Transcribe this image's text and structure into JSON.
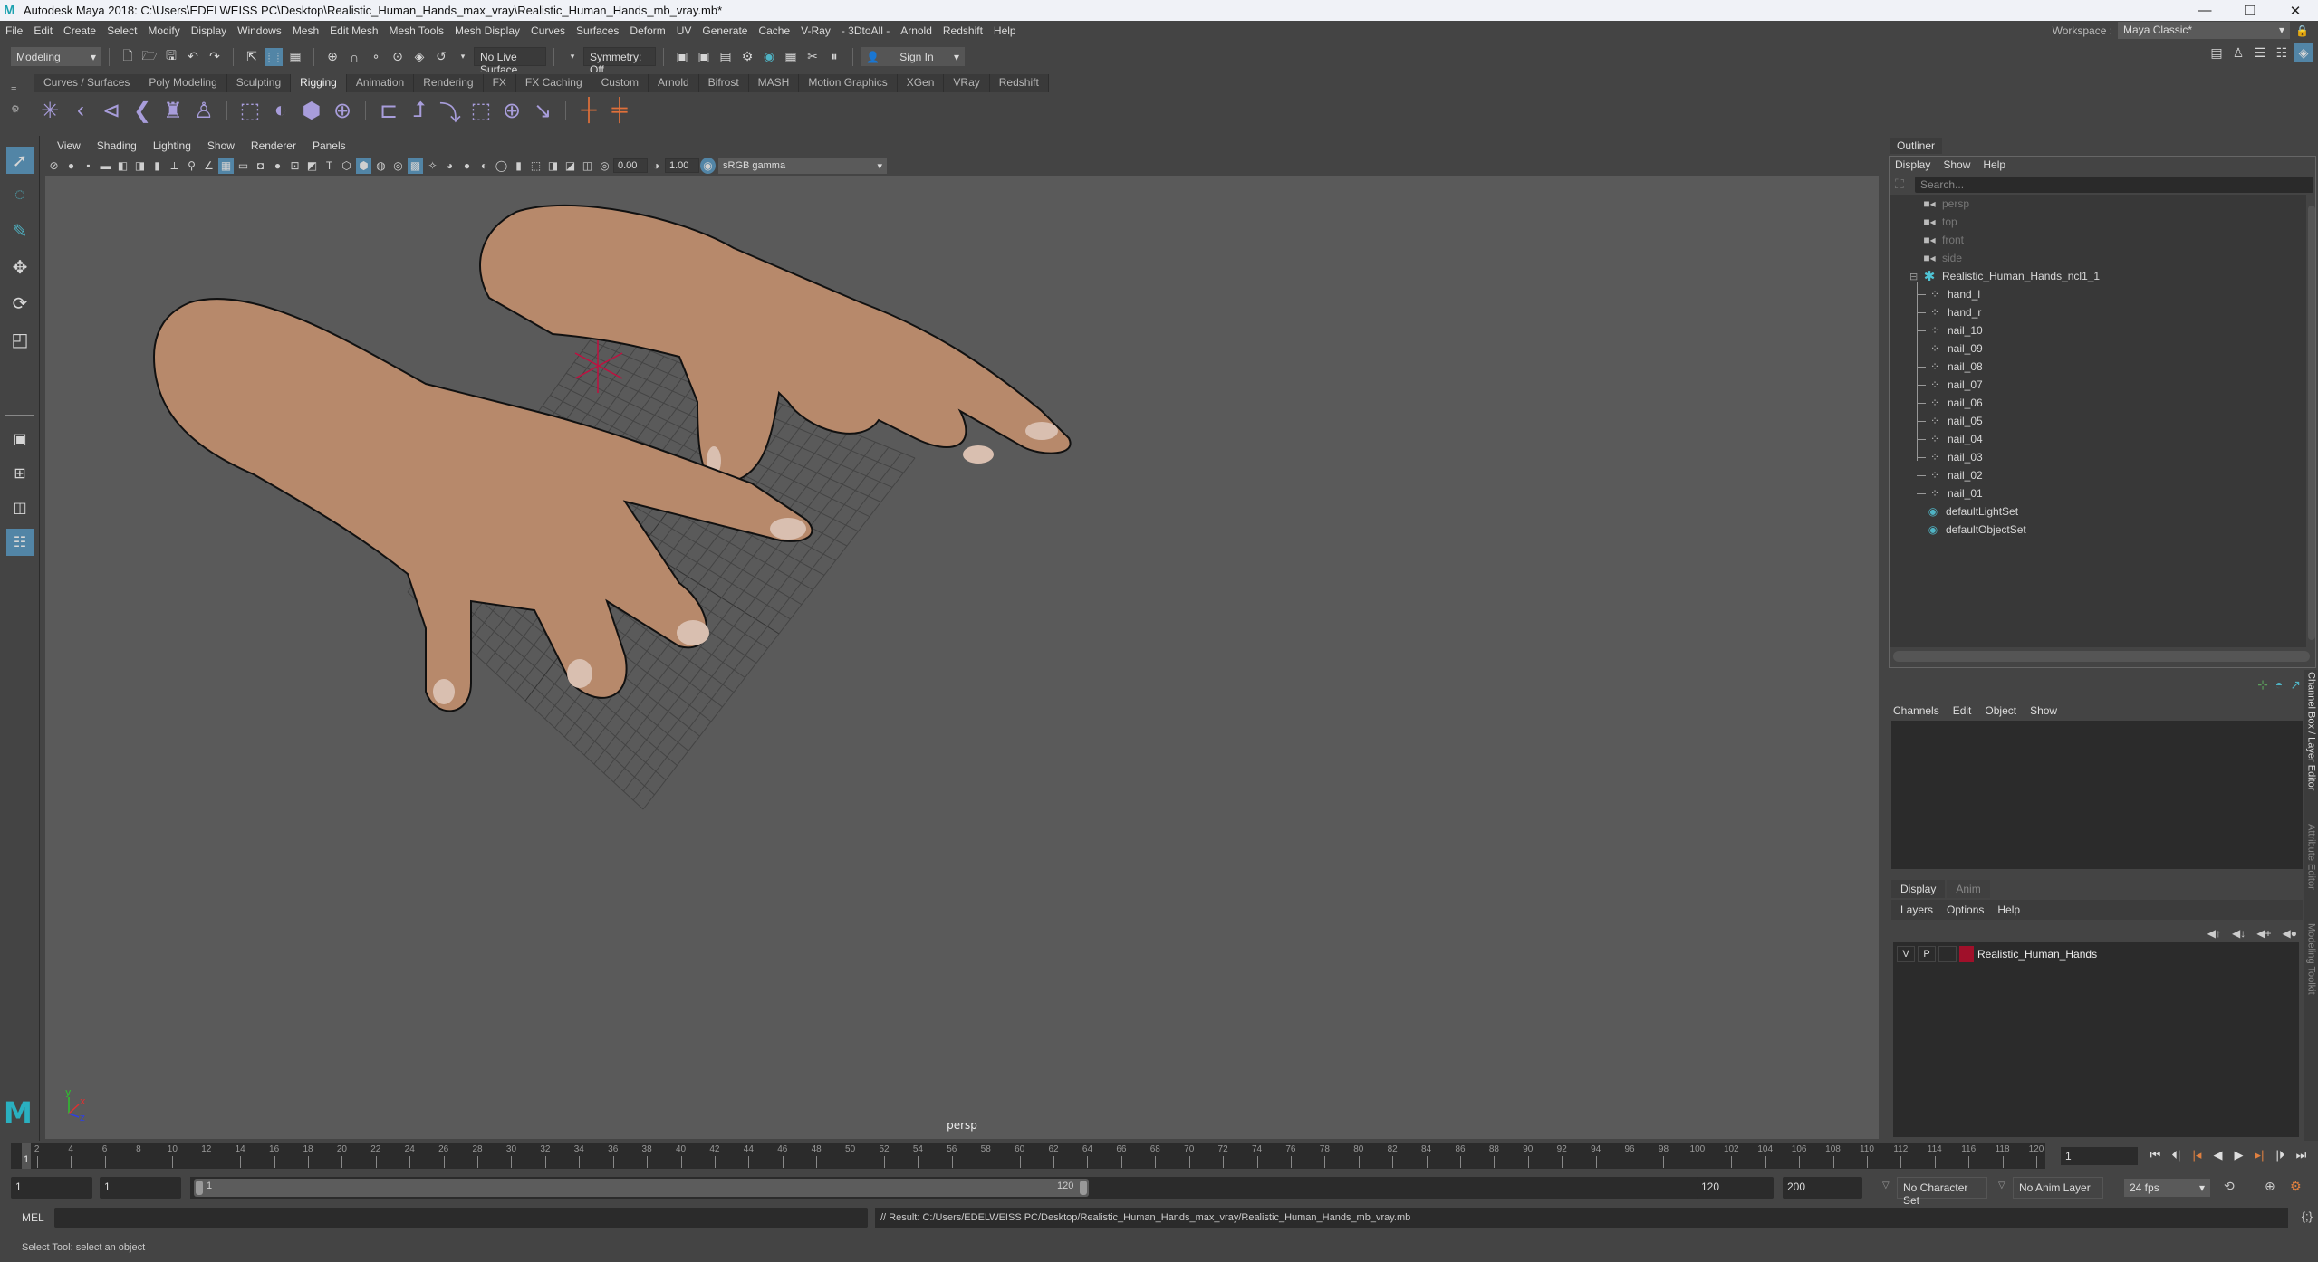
{
  "window": {
    "title": "Autodesk Maya 2018: C:\\Users\\EDELWEISS PC\\Desktop\\Realistic_Human_Hands_max_vray\\Realistic_Human_Hands_mb_vray.mb*",
    "minimize": "—",
    "maximize": "❐",
    "close": "✕"
  },
  "menubar": {
    "items": [
      "File",
      "Edit",
      "Create",
      "Select",
      "Modify",
      "Display",
      "Windows",
      "Mesh",
      "Edit Mesh",
      "Mesh Tools",
      "Mesh Display",
      "Curves",
      "Surfaces",
      "Deform",
      "UV",
      "Generate",
      "Cache",
      "V-Ray",
      "- 3DtoAll -",
      "Arnold",
      "Redshift",
      "Help"
    ],
    "workspace_label": "Workspace :",
    "workspace_value": "Maya Classic*"
  },
  "statusline": {
    "menuset": "Modeling",
    "live_surface": "No Live Surface",
    "symmetry": "Symmetry: Off",
    "sign_in": "Sign In"
  },
  "shelf": {
    "tabs": [
      "Curves / Surfaces",
      "Poly Modeling",
      "Sculpting",
      "Rigging",
      "Animation",
      "Rendering",
      "FX",
      "FX Caching",
      "Custom",
      "Arnold",
      "Bifrost",
      "MASH",
      "Motion Graphics",
      "XGen",
      "VRay",
      "Redshift"
    ],
    "active_tab": "Rigging",
    "icons": [
      "create-joints",
      "insert-joint",
      "mirror-joint",
      "orient-joint",
      "quick-rig",
      "humanik",
      "bind-skin",
      "smooth-bind",
      "lattice",
      "cluster",
      "parent-constraint",
      "point-constraint",
      "orient-constraint",
      "scale-constraint",
      "aim-constraint",
      "pole-vector-constraint",
      "ik-handle",
      "ik-spline-handle"
    ]
  },
  "toolbox": {
    "tools": [
      "select-tool",
      "lasso-tool",
      "paint-select-tool",
      "move-tool",
      "rotate-tool",
      "scale-tool"
    ],
    "layouts": [
      "single-perspective-view",
      "four-view",
      "persp-outliner",
      "outliner-layout"
    ]
  },
  "viewport": {
    "menu": [
      "View",
      "Shading",
      "Lighting",
      "Show",
      "Renderer",
      "Panels"
    ],
    "exposure": "0.00",
    "gamma": "1.00",
    "color_space": "sRGB gamma",
    "camera_label": "persp",
    "axis": {
      "x": "x",
      "y": "y",
      "z": "z"
    }
  },
  "outliner": {
    "title": "Outliner",
    "menu": [
      "Display",
      "Show",
      "Help"
    ],
    "search_placeholder": "Search...",
    "cameras": [
      "persp",
      "top",
      "front",
      "side"
    ],
    "group": "Realistic_Human_Hands_ncl1_1",
    "children": [
      "hand_l",
      "hand_r",
      "nail_10",
      "nail_09",
      "nail_08",
      "nail_07",
      "nail_06",
      "nail_05",
      "nail_04",
      "nail_03",
      "nail_02",
      "nail_01"
    ],
    "sets": [
      "defaultLightSet",
      "defaultObjectSet"
    ]
  },
  "channelbox": {
    "menu": [
      "Channels",
      "Edit",
      "Object",
      "Show"
    ],
    "layer_tabs": [
      "Display",
      "Anim"
    ],
    "layer_menu": [
      "Layers",
      "Options",
      "Help"
    ],
    "layer": {
      "v": "V",
      "p": "P",
      "name": "Realistic_Human_Hands",
      "color": "#a0102a"
    }
  },
  "sidetabs": [
    "Channel Box / Layer Editor",
    "Attribute Editor",
    "Modeling Toolkit"
  ],
  "timeslider": {
    "start": 1,
    "end": 120,
    "step": 2,
    "current_frame": "1"
  },
  "rangeslider": {
    "start": "1",
    "playback_start": "1",
    "range_start_label": "1",
    "range_end_label": "120",
    "playback_end": "120",
    "end": "200",
    "character_set": "No Character Set",
    "anim_layer": "No Anim Layer",
    "fps": "24 fps"
  },
  "cmdline": {
    "mode": "MEL",
    "result": "// Result: C:/Users/EDELWEISS PC/Desktop/Realistic_Human_Hands_max_vray/Realistic_Human_Hands_mb_vray.mb"
  },
  "helpline": {
    "text": "Select Tool: select an object"
  }
}
